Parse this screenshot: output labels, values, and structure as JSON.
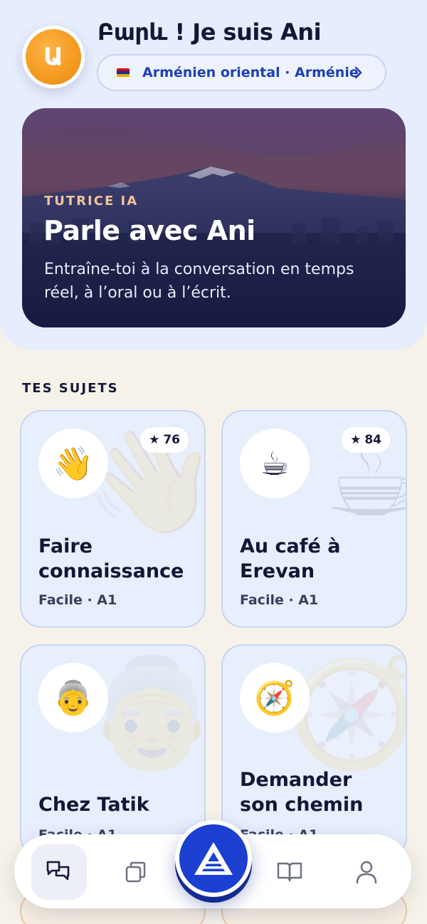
{
  "header": {
    "avatar_letter": "Ա",
    "greeting": "Բարև ! Je suis Ani",
    "language_pill": "Arménien oriental · Arménie",
    "chevron_icon": "chevron-right-icon"
  },
  "hero": {
    "eyebrow": "TUTRICE IA",
    "title": "Parle avec Ani",
    "subtitle": "Entraîne-toi à la conversation en temps réel, à l’oral ou à l’écrit."
  },
  "topics": {
    "section_label": "TES SUJETS",
    "items": [
      {
        "emoji": "👋",
        "score": "76",
        "name": "Faire connaissance",
        "level": "Facile · A1"
      },
      {
        "emoji": "☕",
        "score": "84",
        "name": "Au café à Erevan",
        "level": "Facile · A1"
      },
      {
        "emoji": "👵",
        "score": "",
        "name": "Chez Tatik",
        "level": "Facile · A1"
      },
      {
        "emoji": "🧭",
        "score": "",
        "name": "Demander son chemin",
        "level": "Facile · A1"
      }
    ],
    "star_icon": "★"
  },
  "tabbar": {
    "tabs": [
      {
        "icon": "chat-icon",
        "active": true
      },
      {
        "icon": "cards-icon",
        "active": false
      },
      {
        "icon": "home-logo-icon",
        "active": false
      },
      {
        "icon": "book-icon",
        "active": false
      },
      {
        "icon": "profile-icon",
        "active": false
      }
    ]
  },
  "colors": {
    "accent": "#1a3fd1",
    "avatar": "#f39a1f",
    "panel": "#e6edfc",
    "background": "#f7f2e9"
  }
}
